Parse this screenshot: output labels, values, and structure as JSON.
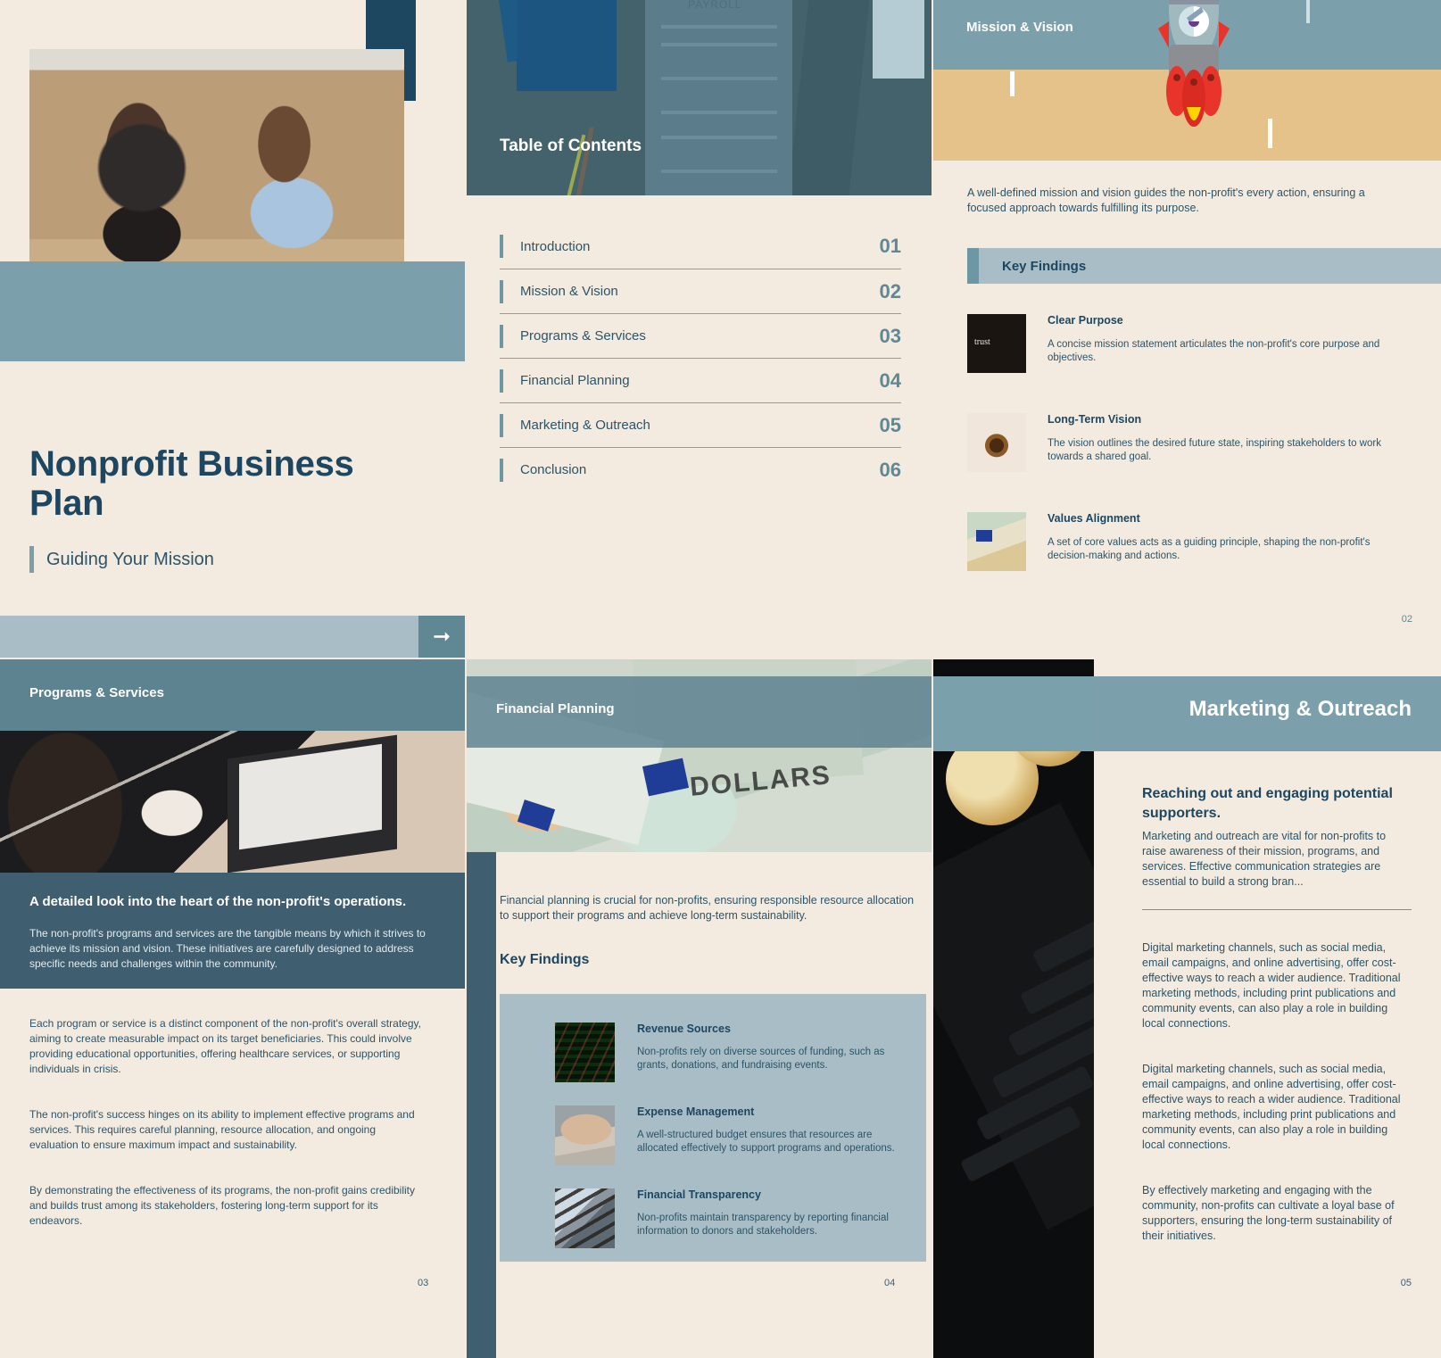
{
  "cover": {
    "title": "Nonprofit Business Plan",
    "subtitle": "Guiding Your Mission",
    "arrow_icon": "arrow-right-icon"
  },
  "toc": {
    "title": "Table of Contents",
    "hero_label": "PAYROLL",
    "items": [
      {
        "label": "Introduction",
        "number": "01"
      },
      {
        "label": "Mission & Vision",
        "number": "02"
      },
      {
        "label": "Programs & Services",
        "number": "03"
      },
      {
        "label": "Financial Planning",
        "number": "04"
      },
      {
        "label": "Marketing & Outreach",
        "number": "05"
      },
      {
        "label": "Conclusion",
        "number": "06"
      }
    ]
  },
  "mission_vision": {
    "title": "Mission & Vision",
    "intro": "A well-defined mission and vision guides the non-profit's every action, ensuring a focused approach towards fulfilling its purpose.",
    "key_findings_label": "Key Findings",
    "items": [
      {
        "heading": "Clear Purpose",
        "text": "A concise mission statement articulates the non-profit's core purpose and objectives.",
        "thumb": "coffee-mug-trust-photo"
      },
      {
        "heading": "Long-Term Vision",
        "text": "The vision outlines the desired future state, inspiring stakeholders to work towards a shared goal.",
        "thumb": "human-eye-photo"
      },
      {
        "heading": "Values Alignment",
        "text": "A set of core values acts as a guiding principle, shaping the non-profit's decision-making and actions.",
        "thumb": "currency-banknotes-photo"
      }
    ],
    "page_number": "02"
  },
  "programs_services": {
    "title": "Programs & Services",
    "lead": "A detailed look into the heart of the non-profit's operations.",
    "lead_paragraph": "The non-profit's programs and services are the tangible means by which it strives to achieve its mission and vision. These initiatives are carefully designed to address specific needs and challenges within the community.",
    "paragraphs": [
      "Each program or service is a distinct component of the non-profit's overall strategy, aiming to create measurable impact on its target beneficiaries. This could involve providing educational opportunities, offering healthcare services, or supporting individuals in crisis.",
      "The non-profit's success hinges on its ability to implement effective programs and services. This requires careful planning, resource allocation, and ongoing evaluation to ensure maximum impact and sustainability.",
      "By demonstrating the effectiveness of its programs, the non-profit gains credibility and builds trust among its stakeholders, fostering long-term support for its endeavors."
    ],
    "page_number": "03"
  },
  "financial_planning": {
    "title": "Financial Planning",
    "intro": "Financial planning is crucial for non-profits, ensuring responsible resource allocation to support their programs and achieve long-term sustainability.",
    "key_findings_label": "Key Findings",
    "items": [
      {
        "heading": "Revenue Sources",
        "text": "Non-profits rely on diverse sources of funding, such as grants, donations, and fundraising events.",
        "thumb": "stock-ticker-board-photo"
      },
      {
        "heading": "Expense Management",
        "text": "A well-structured budget ensures that resources are allocated effectively to support programs and operations.",
        "thumb": "desk-accounting-photo"
      },
      {
        "heading": "Financial Transparency",
        "text": "Non-profits maintain transparency by reporting financial information to donors and stakeholders.",
        "thumb": "glass-staircase-photo"
      }
    ],
    "page_number": "04"
  },
  "marketing_outreach": {
    "title": "Marketing & Outreach",
    "lead": "Reaching out and engaging potential supporters.",
    "lead_paragraph": "Marketing and outreach are vital for non-profits to raise awareness of their mission, programs, and services. Effective communication strategies are essential to build a strong bran...",
    "paragraphs": [
      "Digital marketing channels, such as social media, email campaigns, and online advertising, offer cost-effective ways to reach a wider audience.  Traditional marketing methods, including print publications and community events, can also play a role in building local connections.",
      "Digital marketing channels, such as social media, email campaigns, and online advertising, offer cost-effective ways to reach a wider audience.  Traditional marketing methods, including print publications and community events, can also play a role in building local connections.",
      "By effectively marketing and engaging with the community, non-profits can cultivate a loyal base of supporters, ensuring the long-term sustainability of their initiatives."
    ],
    "page_number": "05"
  },
  "colors": {
    "cream": "#f3ebe0",
    "teal": "#7ba0ab",
    "dark_teal": "#44626b",
    "navy": "#1d4761",
    "steel": "#a8bdc6",
    "slate": "#3f5e70",
    "sand": "#e4c289"
  }
}
